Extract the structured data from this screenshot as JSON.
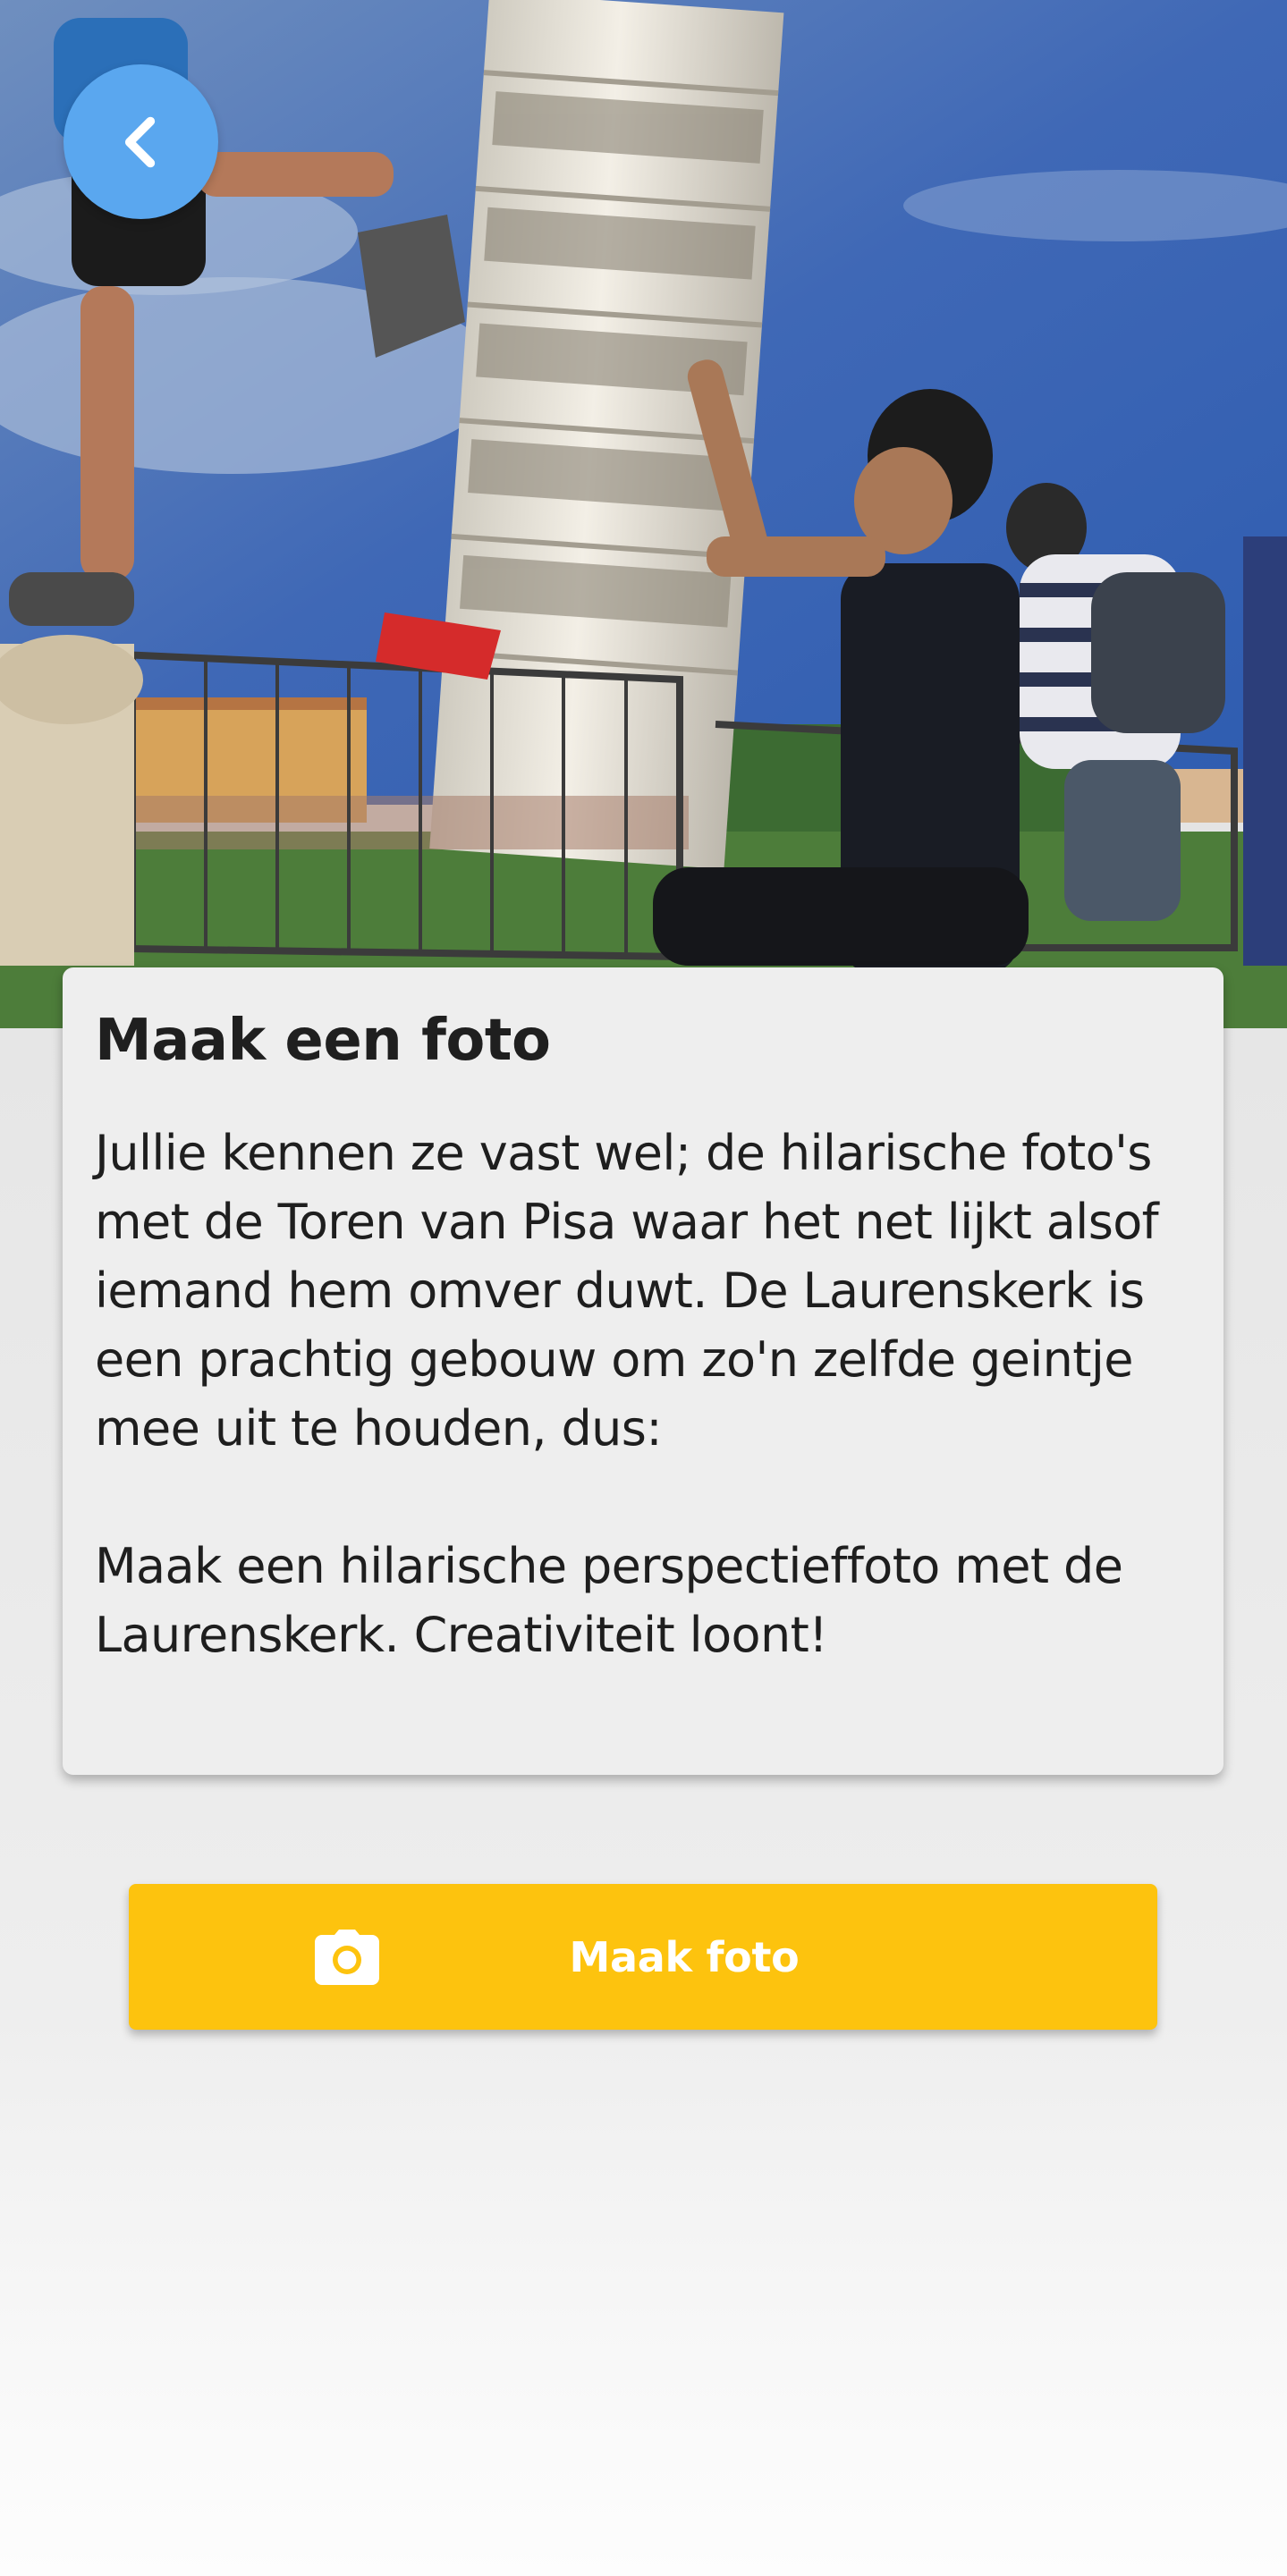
{
  "hero": {
    "icon": "photo-leaning-tower-of-pisa"
  },
  "back_button": {
    "icon": "chevron-left-icon",
    "color": "#5aa7ef"
  },
  "card": {
    "title": "Maak een foto",
    "paragraphs": [
      "Jullie kennen ze vast wel; de hilarische foto's met de Toren van Pisa waar het net lijkt alsof iemand hem omver duwt. De Laurenskerk is een prachtig gebouw om zo'n zelfde geintje mee uit te houden, dus:",
      "Maak een hilarische perspectieffoto met de Laurenskerk. Creativiteit loont!"
    ]
  },
  "action_button": {
    "label": "Maak foto",
    "icon": "camera-icon",
    "color": "#fdc30e"
  }
}
